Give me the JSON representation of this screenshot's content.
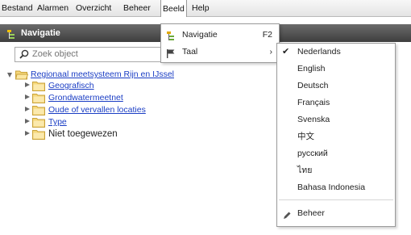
{
  "menubar": {
    "items": [
      {
        "label": "Bestand"
      },
      {
        "label": "Alarmen"
      },
      {
        "label": "Overzicht"
      },
      {
        "label": "Beheer"
      },
      {
        "label": "Beeld"
      },
      {
        "label": "Help"
      }
    ],
    "active_index": 4
  },
  "navigation": {
    "title": "Navigatie",
    "search_placeholder": "Zoek object"
  },
  "tree": {
    "root": "Regionaal meetsysteem Rijn en IJssel",
    "children": [
      {
        "label": "Geografisch",
        "link": true
      },
      {
        "label": "Grondwatermeetnet",
        "link": true
      },
      {
        "label": "Oude of vervallen locaties",
        "link": true
      },
      {
        "label": "Type",
        "link": true
      },
      {
        "label": "Niet toegewezen",
        "link": false
      }
    ]
  },
  "beeld_menu": {
    "items": [
      {
        "label": "Navigatie",
        "shortcut": "F2",
        "icon": "navigation-icon"
      },
      {
        "label": "Taal",
        "submenu_indicator": "›",
        "icon": "flag-icon"
      }
    ]
  },
  "taal_menu": {
    "checkmark": "✔",
    "selected": "Nederlands",
    "languages": [
      "Nederlands",
      "English",
      "Deutsch",
      "Français",
      "Svenska",
      "中文",
      "русский",
      "ไทย",
      "Bahasa Indonesia"
    ],
    "beheer_label": "Beheer"
  }
}
